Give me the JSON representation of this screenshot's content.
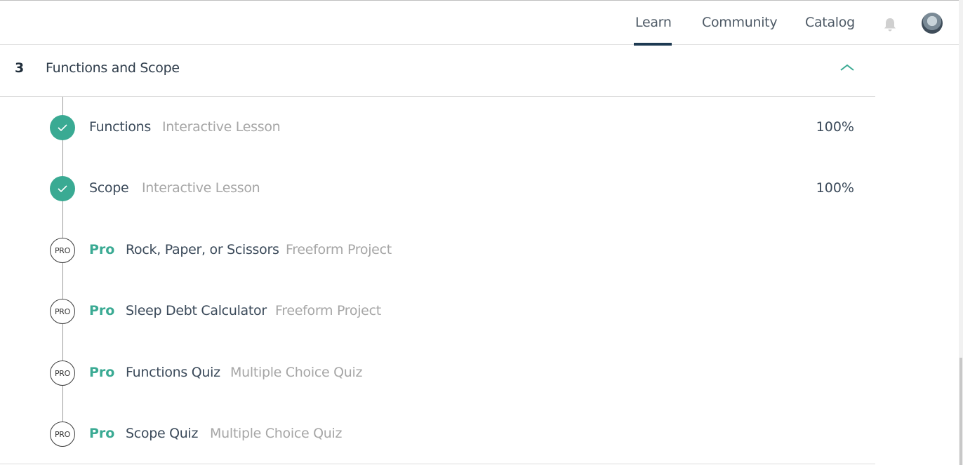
{
  "nav": {
    "links": [
      "Learn",
      "Community",
      "Catalog"
    ],
    "active": "Learn",
    "bell_icon": "bell-icon",
    "avatar_icon": "user-avatar"
  },
  "module": {
    "number": "3",
    "title": "Functions and Scope",
    "toggle_icon": "chevron-up-icon"
  },
  "lessons": [
    {
      "status": "complete",
      "title": "Functions",
      "type": "Interactive Lesson",
      "progress": "100%"
    },
    {
      "status": "complete",
      "title": "Scope",
      "type": "Interactive Lesson",
      "progress": "100%"
    },
    {
      "status": "pro",
      "badge": "PRO",
      "pro_label": "Pro",
      "title": "Rock, Paper, or Scissors",
      "type": "Freeform Project"
    },
    {
      "status": "pro",
      "badge": "PRO",
      "pro_label": "Pro",
      "title": "Sleep Debt Calculator",
      "type": "Freeform Project"
    },
    {
      "status": "pro",
      "badge": "PRO",
      "pro_label": "Pro",
      "title": "Functions Quiz",
      "type": "Multiple Choice Quiz"
    },
    {
      "status": "pro",
      "badge": "PRO",
      "pro_label": "Pro",
      "title": "Scope Quiz",
      "type": "Multiple Choice Quiz"
    }
  ],
  "colors": {
    "accent": "#3aaa93",
    "nav_active": "#1e3a52"
  }
}
